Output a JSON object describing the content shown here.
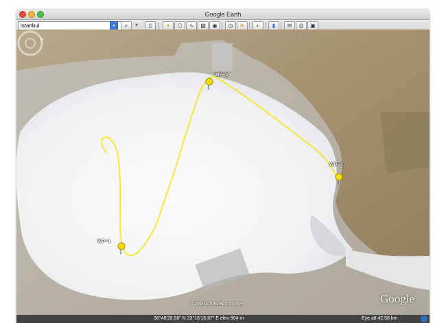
{
  "window": {
    "title": "Google Earth"
  },
  "search": {
    "value": "istanbul"
  },
  "toolbar": {
    "buttons": [
      {
        "name": "search-button",
        "glyph": "🔍"
      },
      {
        "name": "sidebar-toggle-button",
        "glyph": "▤"
      },
      {
        "name": "add-placemark-button",
        "glyph": "📌"
      },
      {
        "name": "add-polygon-button",
        "glyph": "⬠"
      },
      {
        "name": "add-path-button",
        "glyph": "〰"
      },
      {
        "name": "add-overlay-button",
        "glyph": "▦"
      },
      {
        "name": "record-tour-button",
        "glyph": "●"
      },
      {
        "name": "historical-imagery-button",
        "glyph": "◷"
      },
      {
        "name": "sunlight-button",
        "glyph": "☀"
      },
      {
        "name": "sky-switch-button",
        "glyph": "🪐"
      },
      {
        "name": "ruler-button",
        "glyph": "▮"
      },
      {
        "name": "email-button",
        "glyph": "✉"
      },
      {
        "name": "print-button",
        "glyph": "🖶"
      },
      {
        "name": "view-in-maps-button",
        "glyph": "▣"
      }
    ]
  },
  "map": {
    "waypoints": [
      {
        "label": "WP~1"
      },
      {
        "label": "WP~2"
      },
      {
        "label": "WP~3"
      }
    ],
    "copyright": "© 2010 Cnes/Spot Image",
    "logo": "Google",
    "path_color": "#f4e83a"
  },
  "status": {
    "coordinates": "38°48'28.58\" N    33°16'16.87\" E   elev  904 m",
    "eye_alt": "Eye alt    42.58 km"
  }
}
